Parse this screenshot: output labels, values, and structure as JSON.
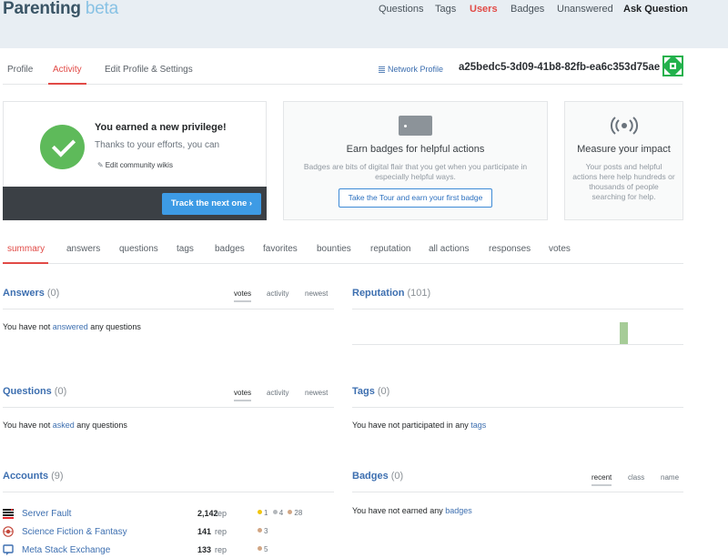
{
  "site": {
    "name": "Parenting",
    "beta": "beta"
  },
  "topnav": [
    "Questions",
    "Tags",
    "Users",
    "Badges",
    "Unanswered",
    "Ask Question"
  ],
  "profile_tabs": [
    "Profile",
    "Activity",
    "Edit Profile & Settings"
  ],
  "network_profile": "Network Profile",
  "username": "a25bedc5-3d09-41b8-82fb-ea6c353d75ae",
  "privilege_card": {
    "title": "You earned a new privilege!",
    "subtitle": "Thanks to your efforts, you can",
    "link": "Edit community wikis",
    "button": "Track the next one ›"
  },
  "badges_card": {
    "title": "Earn badges for helpful actions",
    "description": "Badges are bits of digital flair that you get when you participate in especially helpful ways.",
    "button": "Take the Tour and earn your first badge"
  },
  "impact_card": {
    "title": "Measure your impact",
    "description": "Your posts and helpful actions here help hundreds or thousands of people searching for help."
  },
  "activity_tabs": [
    "summary",
    "answers",
    "questions",
    "tags",
    "badges",
    "favorites",
    "bounties",
    "reputation",
    "all actions",
    "responses",
    "votes"
  ],
  "answers": {
    "title": "Answers",
    "count": "(0)",
    "sort": [
      "votes",
      "activity",
      "newest"
    ],
    "empty_pre": "You have not",
    "empty_link": "answered",
    "empty_post": "any questions"
  },
  "reputation": {
    "title": "Reputation",
    "count": "(101)",
    "chart_level": 0.61
  },
  "questions": {
    "title": "Questions",
    "count": "(0)",
    "sort": [
      "votes",
      "activity",
      "newest"
    ],
    "empty_pre": "You have not",
    "empty_link": "asked",
    "empty_post": "any questions"
  },
  "tags": {
    "title": "Tags",
    "count": "(0)",
    "empty_pre": "You have not participated in any",
    "empty_link": "tags"
  },
  "accounts": {
    "title": "Accounts",
    "count": "(9)",
    "rep_label": "rep",
    "items": [
      {
        "name": "Server Fault",
        "rep": "2,142",
        "icon": "server-fault-icon",
        "gold": "1",
        "silver": "4",
        "bronze": "28"
      },
      {
        "name": "Science Fiction & Fantasy",
        "rep": "141",
        "icon": "scifi-icon",
        "bronze": "3"
      },
      {
        "name": "Meta Stack Exchange",
        "rep": "133",
        "icon": "meta-icon",
        "bronze": "5"
      }
    ]
  },
  "badges": {
    "title": "Badges",
    "count": "(0)",
    "sort": [
      "recent",
      "class",
      "name"
    ],
    "empty_pre": "You have not earned any",
    "empty_link": "badges"
  },
  "colors": {
    "accent": "#e14a46",
    "link": "#3d6fb0",
    "button": "#3d9be5",
    "header_bg": "#e8eef3",
    "rep_bar": "#a6cc97"
  }
}
